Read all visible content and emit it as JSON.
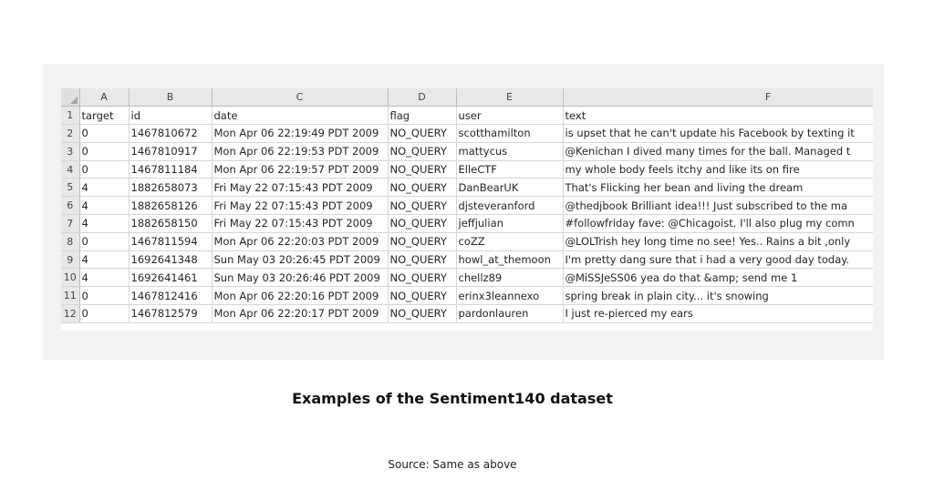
{
  "spreadsheet": {
    "column_letters": [
      "A",
      "B",
      "C",
      "D",
      "E",
      "F"
    ],
    "row_numbers": [
      "1",
      "2",
      "3",
      "4",
      "5",
      "6",
      "7",
      "8",
      "9",
      "10",
      "11",
      "12"
    ],
    "header_row": [
      "target",
      "id",
      "date",
      "flag",
      "user",
      "text"
    ],
    "rows": [
      [
        "0",
        "1467810672",
        "Mon Apr 06 22:19:49 PDT 2009",
        "NO_QUERY",
        "scotthamilton",
        "is upset that he can't update his Facebook by texting it"
      ],
      [
        "0",
        "1467810917",
        "Mon Apr 06 22:19:53 PDT 2009",
        "NO_QUERY",
        "mattycus",
        "@Kenichan I dived many times for the ball. Managed t"
      ],
      [
        "0",
        "1467811184",
        "Mon Apr 06 22:19:57 PDT 2009",
        "NO_QUERY",
        "ElleCTF",
        "my whole body feels itchy and like its on fire"
      ],
      [
        "4",
        "1882658073",
        "Fri May 22 07:15:43 PDT 2009",
        "NO_QUERY",
        "DanBearUK",
        "That's Flicking her bean and living the dream"
      ],
      [
        "4",
        "1882658126",
        "Fri May 22 07:15:43 PDT 2009",
        "NO_QUERY",
        "djsteveranford",
        "@thedjbook Brilliant idea!!! Just subscribed to the ma"
      ],
      [
        "4",
        "1882658150",
        "Fri May 22 07:15:43 PDT 2009",
        "NO_QUERY",
        "jeffjulian",
        "#followfriday fave: @Chicagoist. I'll also plug my comn"
      ],
      [
        "0",
        "1467811594",
        "Mon Apr 06 22:20:03 PDT 2009",
        "NO_QUERY",
        "coZZ",
        "@LOLTrish hey  long time no see! Yes.. Rains a bit ,only"
      ],
      [
        "4",
        "1692641348",
        "Sun May 03 20:26:45 PDT 2009",
        "NO_QUERY",
        "howl_at_themoon",
        "I'm pretty dang sure that i had a very good day today."
      ],
      [
        "4",
        "1692641461",
        "Sun May 03 20:26:46 PDT 2009",
        "NO_QUERY",
        "chellz89",
        "@MiSSJeSS06 yea do that &amp; send me 1"
      ],
      [
        "0",
        "1467812416",
        "Mon Apr 06 22:20:16 PDT 2009",
        "NO_QUERY",
        "erinx3leannexo",
        "spring break in plain city... it's snowing"
      ],
      [
        "0",
        "1467812579",
        "Mon Apr 06 22:20:17 PDT 2009",
        "NO_QUERY",
        "pardonlauren",
        "I just re-pierced my ears"
      ]
    ]
  },
  "caption": "Examples of the Sentiment140 dataset",
  "source": "Source: Same as above"
}
